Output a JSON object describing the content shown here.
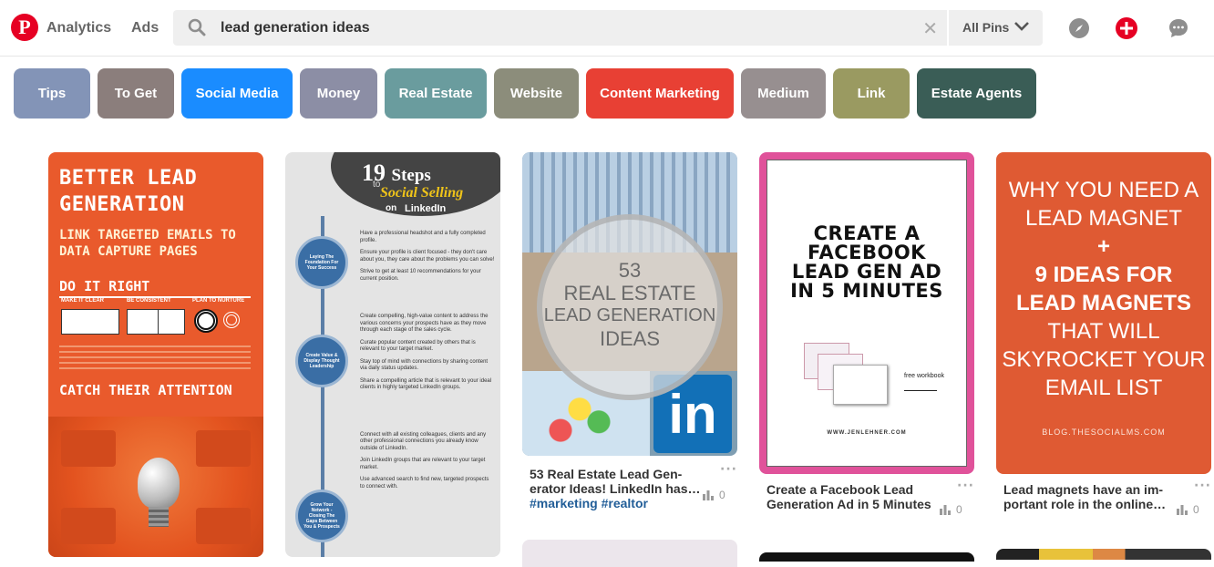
{
  "header": {
    "nav": [
      {
        "label": "Analytics"
      },
      {
        "label": "Ads"
      }
    ],
    "search_value": "lead generation ideas",
    "scope": "All Pins"
  },
  "chips": [
    {
      "label": "Tips",
      "color": "#8394b7"
    },
    {
      "label": "To Get",
      "color": "#8b7e7c"
    },
    {
      "label": "Social Media",
      "color": "#1a8cff"
    },
    {
      "label": "Money",
      "color": "#8c8ea5"
    },
    {
      "label": "Real Estate",
      "color": "#6a9c9e"
    },
    {
      "label": "Website",
      "color": "#8c8d7b"
    },
    {
      "label": "Content Marketing",
      "color": "#e84034"
    },
    {
      "label": "Medium",
      "color": "#978f90"
    },
    {
      "label": "Link",
      "color": "#9a9a61"
    },
    {
      "label": "Estate Agents",
      "color": "#3a5d56"
    }
  ],
  "pins": [
    {
      "img": {
        "heading": [
          "BETTER LEAD",
          "GENERATION"
        ],
        "sub": [
          "LINK TARGETED EMAILS TO",
          "DATA CAPTURE PAGES"
        ],
        "section1": "DO IT RIGHT",
        "steps": [
          "MAKE IT CLEAR",
          "BE CONSISTENT",
          "PLAN TO NURTURE"
        ],
        "section2": "CATCH THEIR ATTENTION"
      }
    },
    {
      "img": {
        "count": "19",
        "steps_word": "Steps",
        "to": "to",
        "script": "Social Selling",
        "on": "on",
        "brand": "LinkedIn",
        "phases": [
          "Laying The Foundation For Your Success",
          "Create Value & Display Thought Leadership",
          "Grow Your Network - Closing The Gaps Between You & Prospects"
        ],
        "items": [
          "Have a professional headshot and a fully completed profile.",
          "Ensure your profile is client focused - they don't care about you, they care about the problems you can solve!",
          "Strive to get at least 10 recommendations for your current position.",
          "Create compelling, high-value content to address the various concerns your prospects have as they move through each stage of the sales cycle.",
          "Curate popular content created by others that is relevant to your target market.",
          "Stay top of mind with connections by sharing content via daily status updates.",
          "Share a compelling article that is relevant to your ideal clients in highly targeted LinkedIn groups.",
          "Connect with all existing colleagues, clients and any other professional connections you already know outside of LinkedIn.",
          "Join LinkedIn groups that are relevant to your target market.",
          "Use advanced search to find new, targeted prospects to connect with."
        ]
      }
    },
    {
      "img": {
        "number": "53",
        "line1": "REAL ESTATE",
        "line2": "LEAD GENERATION",
        "line3": "IDEAS",
        "logo": "in"
      },
      "title": "53 Real Estate Lead Gen-erator Ideas! LinkedIn has…",
      "tags": "#marketing #realtor",
      "saves": "0"
    },
    {
      "img": {
        "line1": "CREATE A",
        "line2": "FACEBOOK",
        "line3": "LEAD GEN AD",
        "line4": "IN 5 MINUTES",
        "note": "free workbook",
        "site": "WWW.JENLEHNER.COM"
      },
      "title": "Create a Facebook Lead Generation Ad in 5 Minutes",
      "saves": "0"
    },
    {
      "img": {
        "line1": "WHY YOU NEED A",
        "line2": "LEAD MAGNET",
        "plus": "+",
        "line3": "9 IDEAS FOR",
        "line4": "LEAD MAGNETS",
        "line5": "THAT WILL",
        "line6": "SKYROCKET YOUR",
        "line7": "EMAIL LIST",
        "site": "BLOG.THESOCIALMS.COM"
      },
      "title": "Lead magnets have an im-portant role in the online…",
      "saves": "0"
    }
  ]
}
